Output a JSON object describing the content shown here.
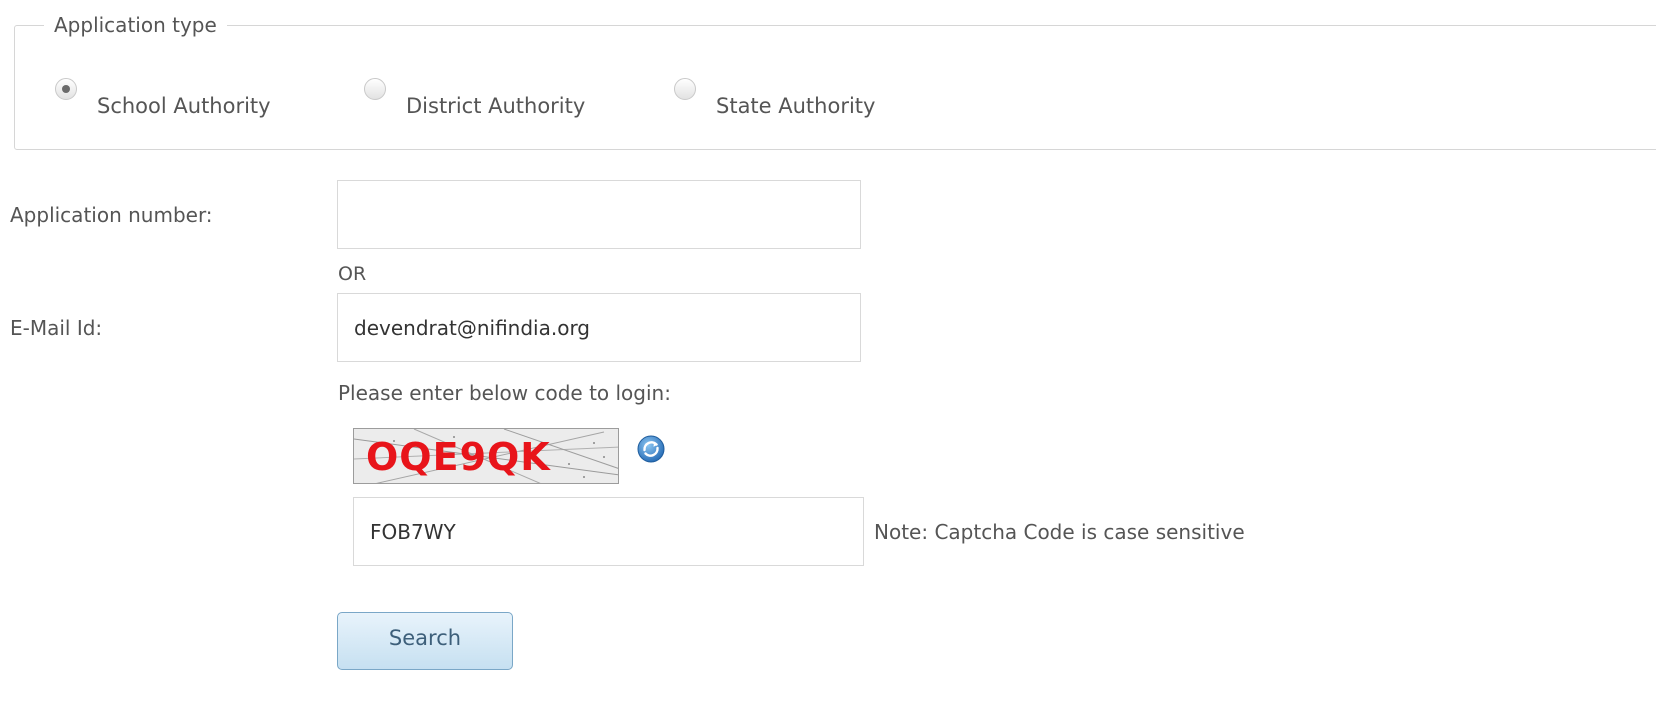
{
  "application_type": {
    "legend": "Application type",
    "options": [
      {
        "label": "School Authority",
        "checked": true
      },
      {
        "label": "District Authority",
        "checked": false
      },
      {
        "label": "State Authority",
        "checked": false
      }
    ]
  },
  "form": {
    "application_number_label": "Application number:",
    "application_number_value": "",
    "or_text": "OR",
    "email_label": "E-Mail Id:",
    "email_value": "devendrat@nifindia.org",
    "captcha_prompt": "Please enter below code to login:",
    "captcha_code": "OQE9QK",
    "captcha_input_value": "FOB7WY",
    "captcha_note": "Note: Captcha Code is case sensitive",
    "search_label": "Search"
  },
  "icons": {
    "refresh": "refresh-icon"
  },
  "colors": {
    "captcha_text": "#e8141a",
    "button_border": "#7aa7c7",
    "refresh_blue": "#2f7bc4"
  }
}
